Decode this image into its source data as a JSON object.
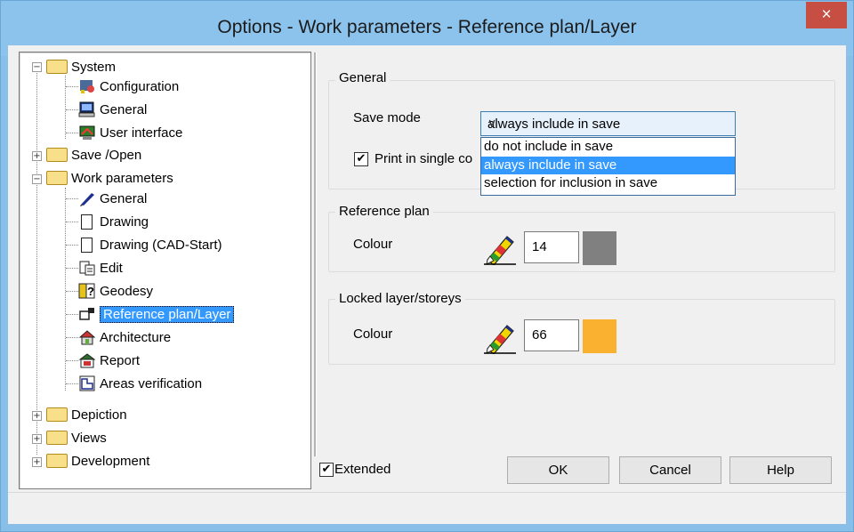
{
  "window": {
    "title": "Options - Work parameters - Reference plan/Layer",
    "close_glyph": "×"
  },
  "tree": {
    "system": {
      "label": "System",
      "expanded": true,
      "children": [
        "Configuration",
        "General",
        "User interface"
      ]
    },
    "save_open": {
      "label": "Save /Open",
      "expanded": false
    },
    "work_parameters": {
      "label": "Work parameters",
      "expanded": true,
      "children": [
        "General",
        "Drawing",
        "Drawing (CAD-Start)",
        "Edit",
        "Geodesy",
        "Reference plan/Layer",
        "Architecture",
        "Report",
        "Areas verification"
      ]
    },
    "depiction": {
      "label": "Depiction",
      "expanded": false
    },
    "views": {
      "label": "Views",
      "expanded": false
    },
    "development": {
      "label": "Development",
      "expanded": false
    },
    "selected": "Reference plan/Layer"
  },
  "general_group": {
    "title": "General",
    "save_mode_label": "Save mode",
    "save_mode_value": "always include in save",
    "options": [
      "do not include in save",
      "always include in save",
      "selection for inclusion in save"
    ],
    "highlighted_index": 1,
    "print_label": "Print in single co",
    "print_checked": true
  },
  "reference_plan": {
    "title": "Reference plan",
    "colour_label": "Colour",
    "colour_value": "14",
    "swatch_color": "#808080"
  },
  "locked_layer": {
    "title": "Locked layer/storeys",
    "colour_label": "Colour",
    "colour_value": "66",
    "swatch_color": "#fbb130"
  },
  "footer": {
    "extended_label": "Extended",
    "extended_checked": true,
    "ok": "OK",
    "cancel": "Cancel",
    "help": "Help"
  },
  "icons": {
    "pencil": "pencil-colour-icon"
  }
}
